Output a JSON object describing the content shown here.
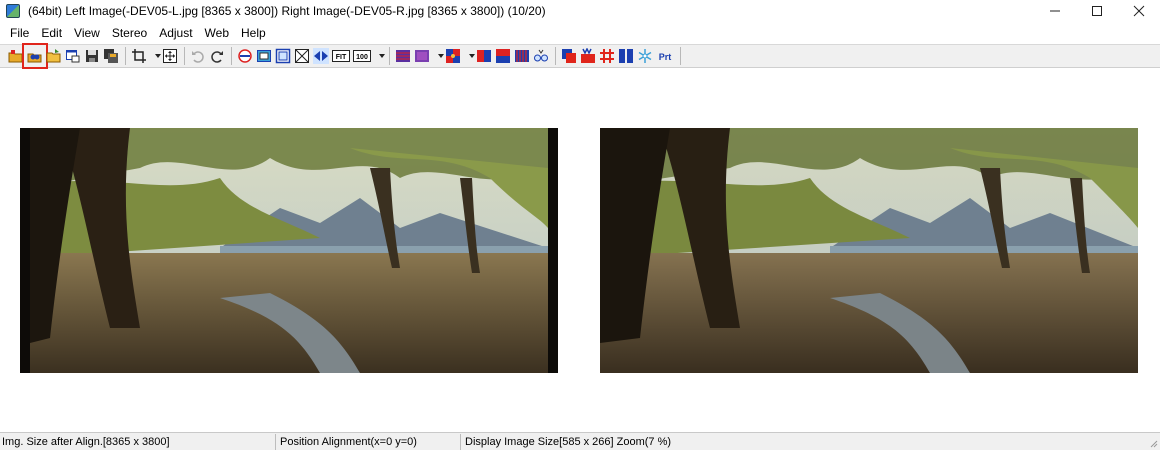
{
  "window": {
    "title": "(64bit) Left Image(-DEV05-L.jpg [8365 x 3800]) Right Image(-DEV05-R.jpg [8365 x 3800])  (10/20)",
    "minimize_icon": "minimize-icon",
    "maximize_icon": "maximize-icon",
    "close_icon": "close-icon"
  },
  "menu": [
    "File",
    "Edit",
    "View",
    "Stereo",
    "Adjust",
    "Web",
    "Help"
  ],
  "toolbar": {
    "fit_label": "FIT",
    "full_label": "100",
    "print_label": "Prt",
    "highlighted_tool": "open-stereo-pair-icon",
    "accent_color": "#e0251b"
  },
  "images": {
    "left_name": "-DEV05-L.jpg",
    "right_name": "-DEV05-R.jpg"
  },
  "status": {
    "size_after_align": "Img. Size after Align.[8365 x 3800]",
    "position_alignment": "Position Alignment(x=0 y=0)",
    "display_size": "Display Image Size[585 x 266]  Zoom(7 %)"
  }
}
